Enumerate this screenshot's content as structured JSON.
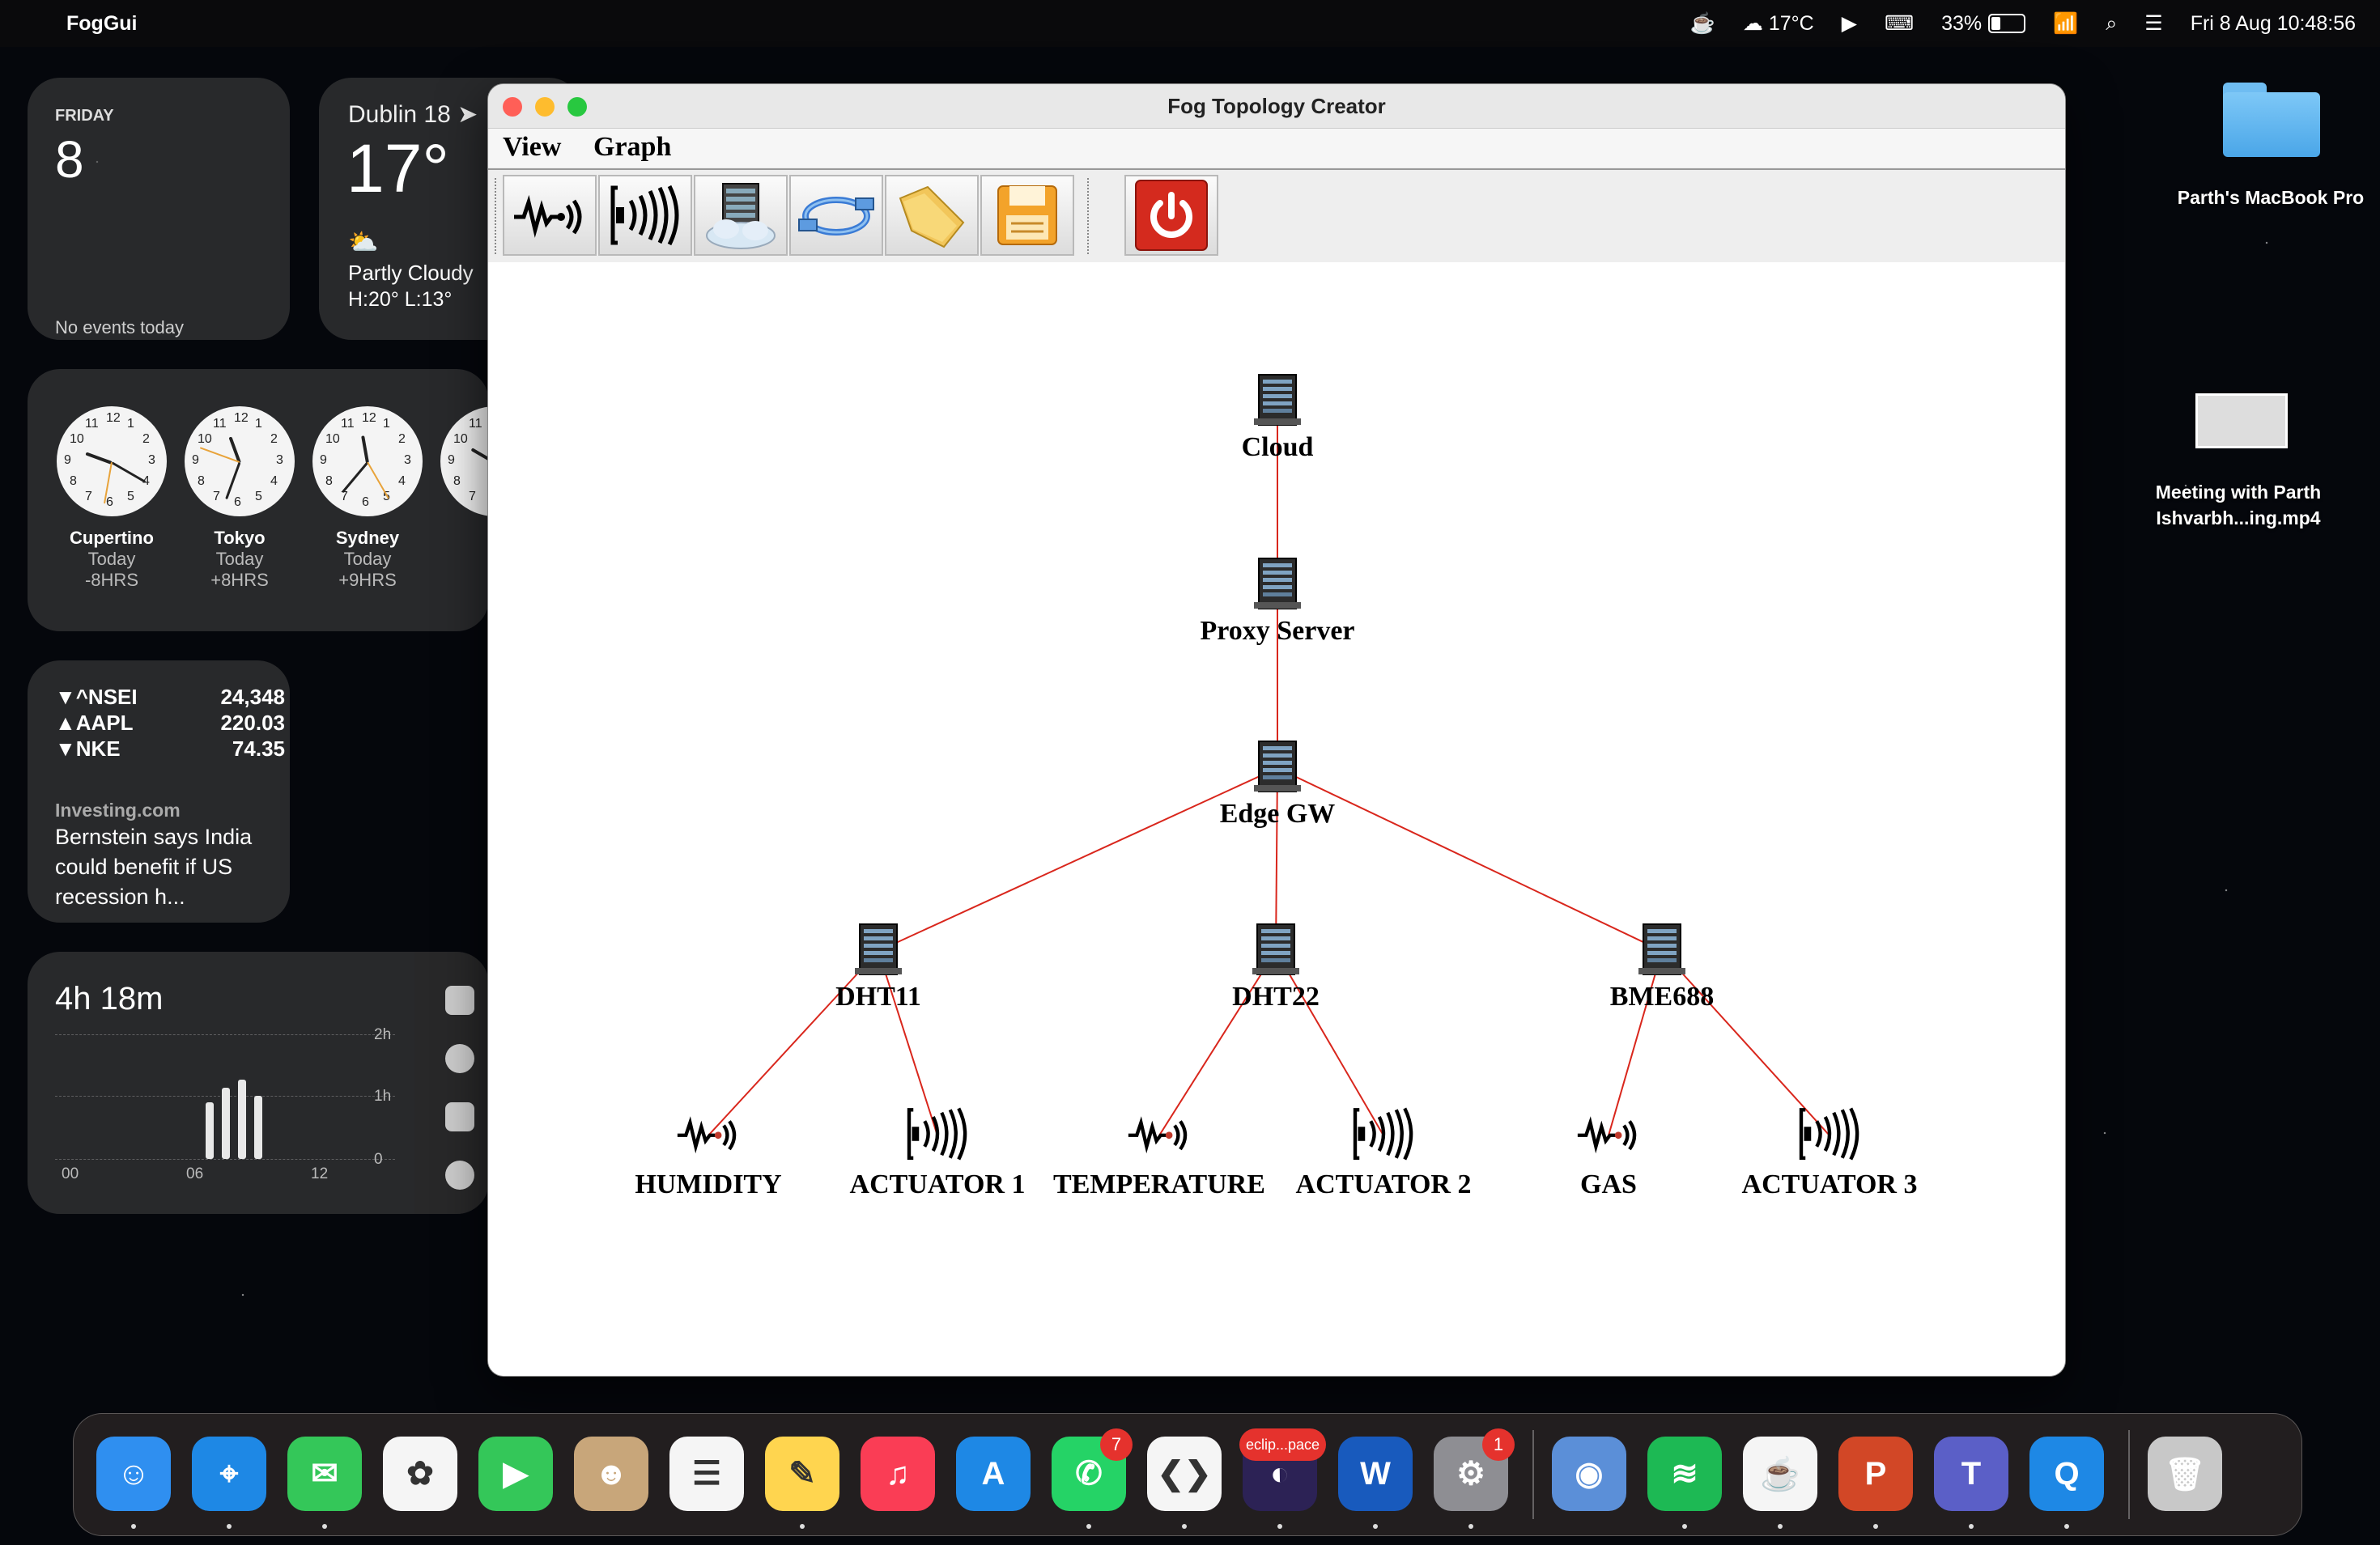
{
  "menubar": {
    "app_name": "FogGui",
    "weather": "17°C",
    "battery": "33%",
    "battery_level": 0.33,
    "datetime": "Fri 8 Aug  10:48:56"
  },
  "widgets": {
    "calendar": {
      "day": "FRIDAY",
      "date": "8",
      "events": "No events today"
    },
    "weather": {
      "city": "Dublin 18",
      "temp": "17°",
      "condition": "Partly Cloudy",
      "highlow": "H:20° L:13°"
    },
    "clocks": [
      {
        "city": "Cupertino",
        "day": "Today",
        "offset": "-8HRS"
      },
      {
        "city": "Tokyo",
        "day": "Today",
        "offset": "+8HRS"
      },
      {
        "city": "Sydney",
        "day": "Today",
        "offset": "+9HRS"
      }
    ],
    "stocks": {
      "rows": [
        {
          "symbol": "▼^NSEI",
          "value": "24,348"
        },
        {
          "symbol": "▲AAPL",
          "value": "220.03"
        },
        {
          "symbol": "▼NKE",
          "value": "74.35"
        }
      ],
      "source": "Investing.com",
      "headline": "Bernstein says India could benefit if US recession h..."
    },
    "screentime": {
      "total": "4h 18m",
      "y_labels": [
        "2h",
        "1h",
        "0"
      ],
      "x_labels": [
        "00",
        "06",
        "12"
      ]
    }
  },
  "desktop": {
    "folder_label": "Parth's MacBook Pro",
    "video_label": "Meeting with Parth Ishvarbh...ing.mp4"
  },
  "window": {
    "title": "Fog Topology Creator",
    "menu": [
      "View",
      "Graph"
    ],
    "toolbar": [
      {
        "name": "sensor-tool",
        "icon": "sensor-icon"
      },
      {
        "name": "actuator-tool",
        "icon": "actuator-icon"
      },
      {
        "name": "fog-device-tool",
        "icon": "server-cloud-icon"
      },
      {
        "name": "link-tool",
        "icon": "cable-icon"
      },
      {
        "name": "open-tool",
        "icon": "folder-icon"
      },
      {
        "name": "save-tool",
        "icon": "floppy-icon"
      },
      {
        "name": "quit-tool",
        "icon": "power-icon"
      }
    ]
  },
  "topology": {
    "nodes": [
      {
        "id": "cloud",
        "label": "Cloud",
        "type": "server"
      },
      {
        "id": "proxy",
        "label": "Proxy Server",
        "type": "server"
      },
      {
        "id": "edge",
        "label": "Edge GW",
        "type": "server"
      },
      {
        "id": "dht11",
        "label": "DHT11",
        "type": "server"
      },
      {
        "id": "dht22",
        "label": "DHT22",
        "type": "server"
      },
      {
        "id": "bme688",
        "label": "BME688",
        "type": "server"
      },
      {
        "id": "humidity",
        "label": "HUMIDITY",
        "type": "sensor"
      },
      {
        "id": "act1",
        "label": "ACTUATOR 1",
        "type": "actuator"
      },
      {
        "id": "temperature",
        "label": "TEMPERATURE",
        "type": "sensor"
      },
      {
        "id": "act2",
        "label": "ACTUATOR 2",
        "type": "actuator"
      },
      {
        "id": "gas",
        "label": "GAS",
        "type": "sensor"
      },
      {
        "id": "act3",
        "label": "ACTUATOR 3",
        "type": "actuator"
      }
    ],
    "edges": [
      [
        "cloud",
        "proxy"
      ],
      [
        "proxy",
        "edge"
      ],
      [
        "edge",
        "dht11"
      ],
      [
        "edge",
        "dht22"
      ],
      [
        "edge",
        "bme688"
      ],
      [
        "dht11",
        "humidity"
      ],
      [
        "dht11",
        "act1"
      ],
      [
        "dht22",
        "temperature"
      ],
      [
        "dht22",
        "act2"
      ],
      [
        "bme688",
        "gas"
      ],
      [
        "bme688",
        "act3"
      ]
    ],
    "edge_color": "#d9261c"
  },
  "dock": {
    "apps": [
      {
        "name": "Finder",
        "color": "#2f8ff0"
      },
      {
        "name": "Safari",
        "color": "#1e88e5"
      },
      {
        "name": "Messages",
        "color": "#34c759"
      },
      {
        "name": "Photos",
        "color": "#f5f5f5"
      },
      {
        "name": "FaceTime",
        "color": "#34c759"
      },
      {
        "name": "Contacts",
        "color": "#c8a67a"
      },
      {
        "name": "Reminders",
        "color": "#f5f5f5"
      },
      {
        "name": "Notes",
        "color": "#ffd54f"
      },
      {
        "name": "Music",
        "color": "#fa3d55"
      },
      {
        "name": "App Store",
        "color": "#1e88e5"
      },
      {
        "name": "WhatsApp",
        "color": "#25d366",
        "badge": "7"
      },
      {
        "name": "VS Code",
        "color": "#f5f5f5"
      },
      {
        "name": "Eclipse",
        "color": "#2c2255",
        "badge": "eclip...pace"
      },
      {
        "name": "Word",
        "color": "#185abd"
      },
      {
        "name": "System Settings",
        "color": "#8e8e93",
        "badge": "1"
      },
      {
        "name": "Finder2",
        "color": "#5b8fd8"
      },
      {
        "name": "Spotify",
        "color": "#1db954"
      },
      {
        "name": "Java",
        "color": "#f5f5f5"
      },
      {
        "name": "PowerPoint",
        "color": "#d24726"
      },
      {
        "name": "Teams",
        "color": "#5b5fc7"
      },
      {
        "name": "QuickTime",
        "color": "#1e88e5"
      },
      {
        "name": "Trash",
        "color": "#c8c8c8"
      }
    ]
  }
}
